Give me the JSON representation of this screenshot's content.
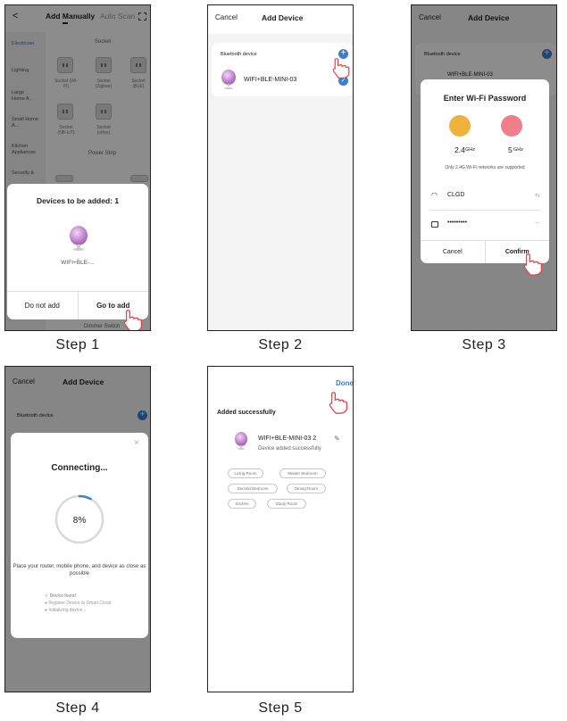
{
  "steps": {
    "s1": {
      "label": "Step 1",
      "header": {
        "back": "<",
        "tab_active": "Add Manually",
        "tab_inactive": "Auto Scan"
      },
      "sidebar": [
        "Electrician",
        "Lighting",
        "Large Home A...",
        "Small Home A...",
        "Kitchen Appliances",
        "Security &"
      ],
      "grid_header": "Socket",
      "devices": [
        "Socket (Wi-Fi)",
        "Socket (Zigbee)",
        "Socket (BLE)",
        "Socket (NB-IoT)",
        "Socket (other)"
      ],
      "power_strip": "Power Strip",
      "dimmer": "Dimmer Switch",
      "popup_title": "Devices to be added: 1",
      "device_name": "WIFI+BLE-...",
      "btn_no": "Do not add",
      "btn_go": "Go to add"
    },
    "s2": {
      "label": "Step 2",
      "cancel": "Cancel",
      "title": "Add Device",
      "section": "Bluetooth device",
      "device_name": "WIFI+BLE-MINI-03"
    },
    "s3": {
      "label": "Step 3",
      "cancel": "Cancel",
      "title": "Add Device",
      "section": "Bluetooth device",
      "device_name_partial": "WIFI+BLE-MINI-03",
      "dialog_title": "Enter Wi-Fi Password",
      "band_24_main": "2.4",
      "band_24_unit": "GHz",
      "band_5_main": "5",
      "band_5_unit": "GHz",
      "note": "Only 2.4G Wi-Fi networks are supported",
      "ssid": "CLGD",
      "password": "•••••••••",
      "btn_cancel": "Cancel",
      "btn_confirm": "Confirm"
    },
    "s4": {
      "label": "Step 4",
      "cancel": "Cancel",
      "title": "Add Device",
      "section": "Bluetooth device",
      "dialog_title": "Connecting...",
      "percent": "8%",
      "progress": 0.08,
      "hint": "Place your router, mobile phone, and device as close as possible",
      "list": [
        "Device found",
        "Register Device to Smart Cloud",
        "Initializing device..."
      ]
    },
    "s5": {
      "label": "Step 5",
      "done": "Done",
      "success": "Added successfully",
      "device_name": "WIFI+BLE-MINI-03 2",
      "device_status": "Device added successfully",
      "rooms": [
        "Living Room",
        "Master Bedroom",
        "Second Bedroom",
        "Dining Room",
        "Kitchen",
        "Study Room"
      ]
    }
  },
  "colors": {
    "accent": "#3c7dd6",
    "warn_face": "#f0b23c",
    "sad_face": "#f07f8b",
    "lamp": "#b472c4"
  }
}
